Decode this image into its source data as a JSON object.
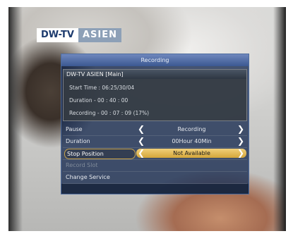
{
  "overlay": {
    "channel_logo": {
      "left": "DW-TV",
      "right": "ASIEN"
    }
  },
  "dialog": {
    "title": "Recording",
    "info": {
      "channel": "DW-TV ASIEN [Main]",
      "start_time": "Start Time : 06:25/30/04",
      "duration": "Duration - 00 : 40 : 00",
      "recording": "Recording - 00 : 07 : 09 (17%)"
    },
    "menu": [
      {
        "label": "Pause",
        "value": "Recording"
      },
      {
        "label": "Duration",
        "value": "00Hour 40Min"
      },
      {
        "label": "Stop Position",
        "value": "Not Available"
      },
      {
        "label": "Record Slot"
      },
      {
        "label": "Change Service"
      }
    ]
  },
  "icons": {
    "chevron_left": "❮",
    "chevron_right": "❯"
  }
}
